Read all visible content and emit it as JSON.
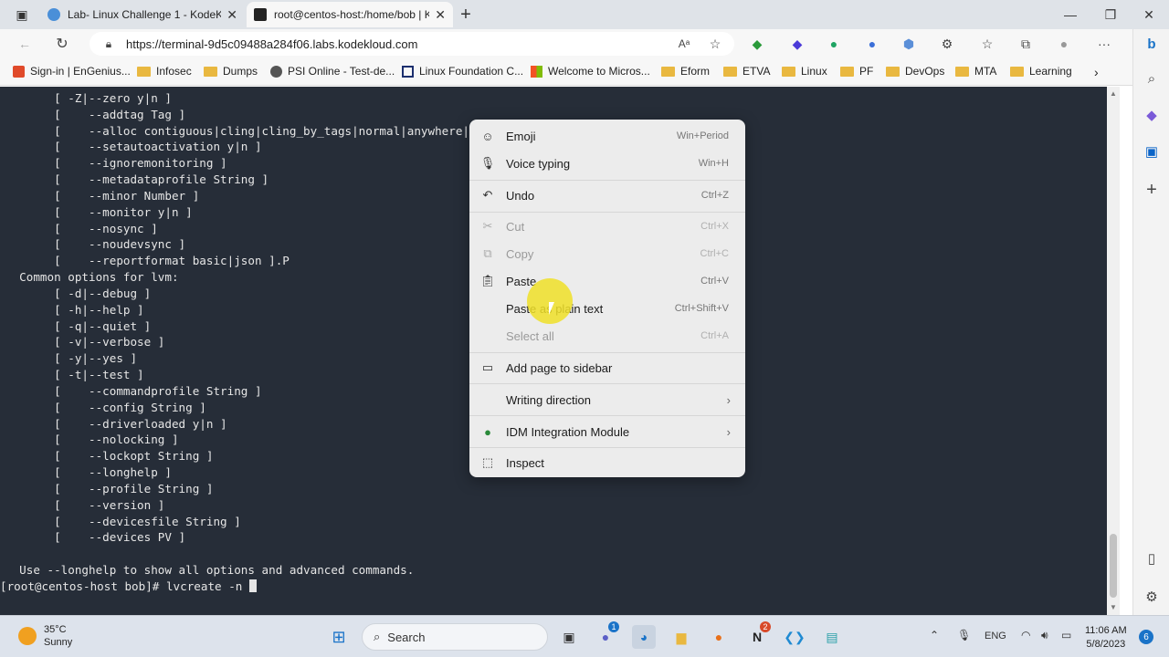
{
  "browser": {
    "tabs": [
      {
        "title": "Lab- Linux Challenge 1 - KodeKl",
        "active": false
      },
      {
        "title": "root@centos-host:/home/bob | K",
        "active": true
      }
    ],
    "url": "https://terminal-9d5c09488a284f06.labs.kodekloud.com",
    "favorites": [
      "Sign-in | EnGenius...",
      "Infosec",
      "Dumps",
      "PSI Online - Test-de...",
      "Linux Foundation C...",
      "Welcome to Micros...",
      "Eform",
      "ETVA",
      "Linux",
      "PF",
      "DevOps",
      "MTA",
      "Learning"
    ]
  },
  "terminal": {
    "lines": [
      "       [ -Z|--zero y|n ]",
      "       [    --addtag Tag ]",
      "       [    --alloc contiguous|cling|cling_by_tags|normal|anywhere|",
      "       [    --setautoactivation y|n ]",
      "       [    --ignoremonitoring ]",
      "       [    --metadataprofile String ]",
      "       [    --minor Number ]",
      "       [    --monitor y|n ]",
      "       [    --nosync ]",
      "       [    --noudevsync ]",
      "       [    --reportformat basic|json ].P",
      "  Common options for lvm:",
      "       [ -d|--debug ]",
      "       [ -h|--help ]",
      "       [ -q|--quiet ]",
      "       [ -v|--verbose ]",
      "       [ -y|--yes ]",
      "       [ -t|--test ]",
      "       [    --commandprofile String ]",
      "       [    --config String ]",
      "       [    --driverloaded y|n ]",
      "       [    --nolocking ]",
      "       [    --lockopt String ]",
      "       [    --longhelp ]",
      "       [    --profile String ]",
      "       [    --version ]",
      "       [    --devicesfile String ]",
      "       [    --devices PV ]",
      "",
      "  Use --longhelp to show all options and advanced commands."
    ],
    "prompt": "[root@centos-host bob]# lvcreate -n "
  },
  "context_menu": {
    "items": [
      {
        "label": "Emoji",
        "shortcut": "Win+Period",
        "icon": "emoji-icon",
        "disabled": false
      },
      {
        "label": "Voice typing",
        "shortcut": "Win+H",
        "icon": "microphone-icon",
        "disabled": false
      },
      {
        "label": "Undo",
        "shortcut": "Ctrl+Z",
        "icon": "undo-icon",
        "disabled": false
      },
      {
        "label": "Cut",
        "shortcut": "Ctrl+X",
        "icon": "scissors-icon",
        "disabled": true
      },
      {
        "label": "Copy",
        "shortcut": "Ctrl+C",
        "icon": "copy-icon",
        "disabled": true
      },
      {
        "label": "Paste",
        "shortcut": "Ctrl+V",
        "icon": "paste-icon",
        "disabled": false
      },
      {
        "label": "Paste as plain text",
        "shortcut": "Ctrl+Shift+V",
        "icon": "",
        "disabled": false
      },
      {
        "label": "Select all",
        "shortcut": "Ctrl+A",
        "icon": "",
        "disabled": true
      },
      {
        "label": "Add page to sidebar",
        "shortcut": "",
        "icon": "sidebar-icon",
        "disabled": false
      },
      {
        "label": "Writing direction",
        "shortcut": "",
        "icon": "",
        "disabled": false
      },
      {
        "label": "IDM Integration Module",
        "shortcut": "",
        "icon": "idm-icon",
        "disabled": false
      },
      {
        "label": "Inspect",
        "shortcut": "",
        "icon": "inspect-icon",
        "disabled": false
      }
    ]
  },
  "taskbar": {
    "weather_temp": "35°C",
    "weather_desc": "Sunny",
    "search_label": "Search",
    "language": "ENG",
    "time": "11:06 AM",
    "date": "5/8/2023",
    "notifications": "6",
    "teams_badge": "1",
    "onenote_badge": "2"
  },
  "colors": {
    "terminal_bg": "#262d38",
    "terminal_fg": "#e6e6e6",
    "menu_bg": "#ececec",
    "accent": "#1a73c8"
  }
}
